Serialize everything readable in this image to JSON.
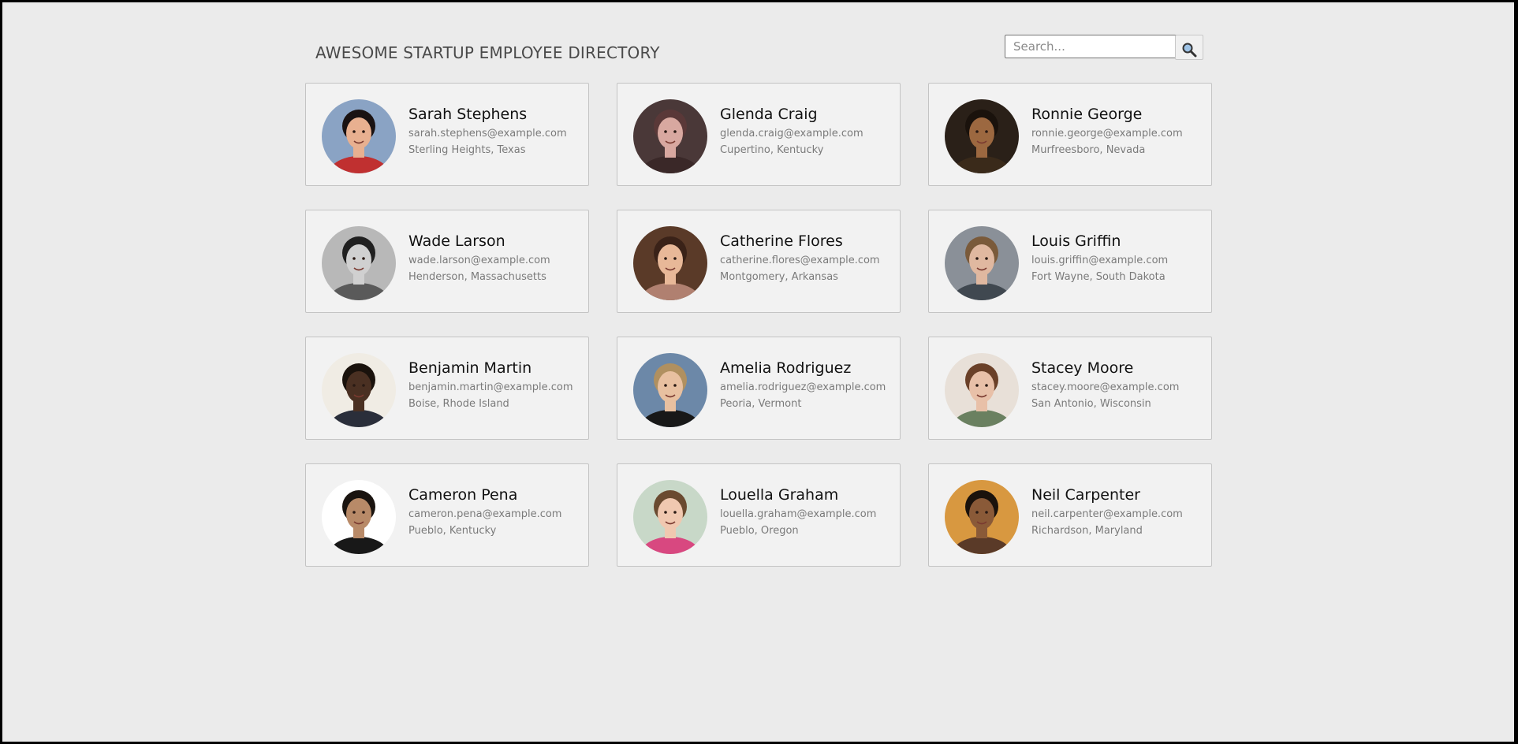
{
  "header": {
    "title": "AWESOME STARTUP EMPLOYEE DIRECTORY"
  },
  "search": {
    "placeholder": "Search...",
    "button_icon": "search-icon"
  },
  "employees": [
    {
      "name": "Sarah Stephens",
      "email": "sarah.stephens@example.com",
      "location": "Sterling Heights, Texas",
      "bg": "#8aa3c4",
      "skin": "#e8b090",
      "hair": "#1a1212",
      "shirt": "#c03030"
    },
    {
      "name": "Glenda Craig",
      "email": "glenda.craig@example.com",
      "location": "Cupertino, Kentucky",
      "bg": "#4a3838",
      "skin": "#d8a8a0",
      "hair": "#5a3838",
      "shirt": "#3a2828"
    },
    {
      "name": "Ronnie George",
      "email": "ronnie.george@example.com",
      "location": "Murfreesboro, Nevada",
      "bg": "#2a2018",
      "skin": "#9c6840",
      "hair": "#1a120c",
      "shirt": "#3a2a1a"
    },
    {
      "name": "Wade Larson",
      "email": "wade.larson@example.com",
      "location": "Henderson, Massachusetts",
      "bg": "#b8b8b8",
      "skin": "#d0d0d0",
      "hair": "#202020",
      "shirt": "#5a5a5a"
    },
    {
      "name": "Catherine Flores",
      "email": "catherine.flores@example.com",
      "location": "Montgomery, Arkansas",
      "bg": "#5a3a28",
      "skin": "#e8b898",
      "hair": "#3a2218",
      "shirt": "#b08070"
    },
    {
      "name": "Louis Griffin",
      "email": "louis.griffin@example.com",
      "location": "Fort Wayne, South Dakota",
      "bg": "#8a9098",
      "skin": "#e0b8a0",
      "hair": "#7a5a3a",
      "shirt": "#404850"
    },
    {
      "name": "Benjamin Martin",
      "email": "benjamin.martin@example.com",
      "location": "Boise, Rhode Island",
      "bg": "#f0ece4",
      "skin": "#4a3022",
      "hair": "#1a120c",
      "shirt": "#2a2e3a"
    },
    {
      "name": "Amelia Rodriguez",
      "email": "amelia.rodriguez@example.com",
      "location": "Peoria, Vermont",
      "bg": "#6c88a8",
      "skin": "#e8c0a0",
      "hair": "#b09060",
      "shirt": "#181818"
    },
    {
      "name": "Stacey Moore",
      "email": "stacey.moore@example.com",
      "location": "San Antonio, Wisconsin",
      "bg": "#e8e0d8",
      "skin": "#e8c0a8",
      "hair": "#6a4028",
      "shirt": "#6a8060"
    },
    {
      "name": "Cameron Pena",
      "email": "cameron.pena@example.com",
      "location": "Pueblo, Kentucky",
      "bg": "#ffffff",
      "skin": "#b88a68",
      "hair": "#1a1410",
      "shirt": "#181818"
    },
    {
      "name": "Louella Graham",
      "email": "louella.graham@example.com",
      "location": "Pueblo, Oregon",
      "bg": "#c8d8c8",
      "skin": "#f0c8b0",
      "hair": "#6a4a30",
      "shirt": "#d84880"
    },
    {
      "name": "Neil Carpenter",
      "email": "neil.carpenter@example.com",
      "location": "Richardson, Maryland",
      "bg": "#d89840",
      "skin": "#8a5a38",
      "hair": "#1a120c",
      "shirt": "#5a3a28"
    }
  ]
}
